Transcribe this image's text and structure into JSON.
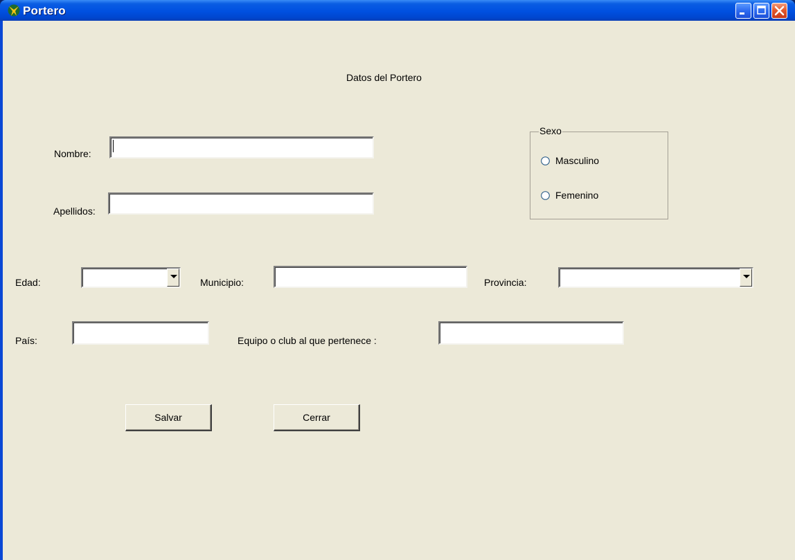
{
  "window": {
    "title": "Portero",
    "icon": "app-logo-icon",
    "controls": [
      "minimize-icon",
      "maximize-icon",
      "close-icon"
    ]
  },
  "form": {
    "heading": "Datos del Portero",
    "nombre": {
      "label": "Nombre:",
      "value": ""
    },
    "apellidos": {
      "label": "Apellidos:",
      "value": ""
    },
    "sexo": {
      "label": "Sexo",
      "options": [
        "Masculino",
        "Femenino"
      ]
    },
    "edad": {
      "label": "Edad:",
      "value": ""
    },
    "municipio": {
      "label": "Municipio:",
      "value": ""
    },
    "provincia": {
      "label": "Provincia:",
      "value": ""
    },
    "pais": {
      "label": "País:",
      "value": ""
    },
    "equipo": {
      "label": "Equipo o club al que pertenece :",
      "value": ""
    }
  },
  "buttons": {
    "salvar": "Salvar",
    "cerrar": "Cerrar"
  },
  "colors": {
    "titlebar": "#0050E0",
    "face": "#ECE9D8",
    "close": "#E45A2E"
  }
}
